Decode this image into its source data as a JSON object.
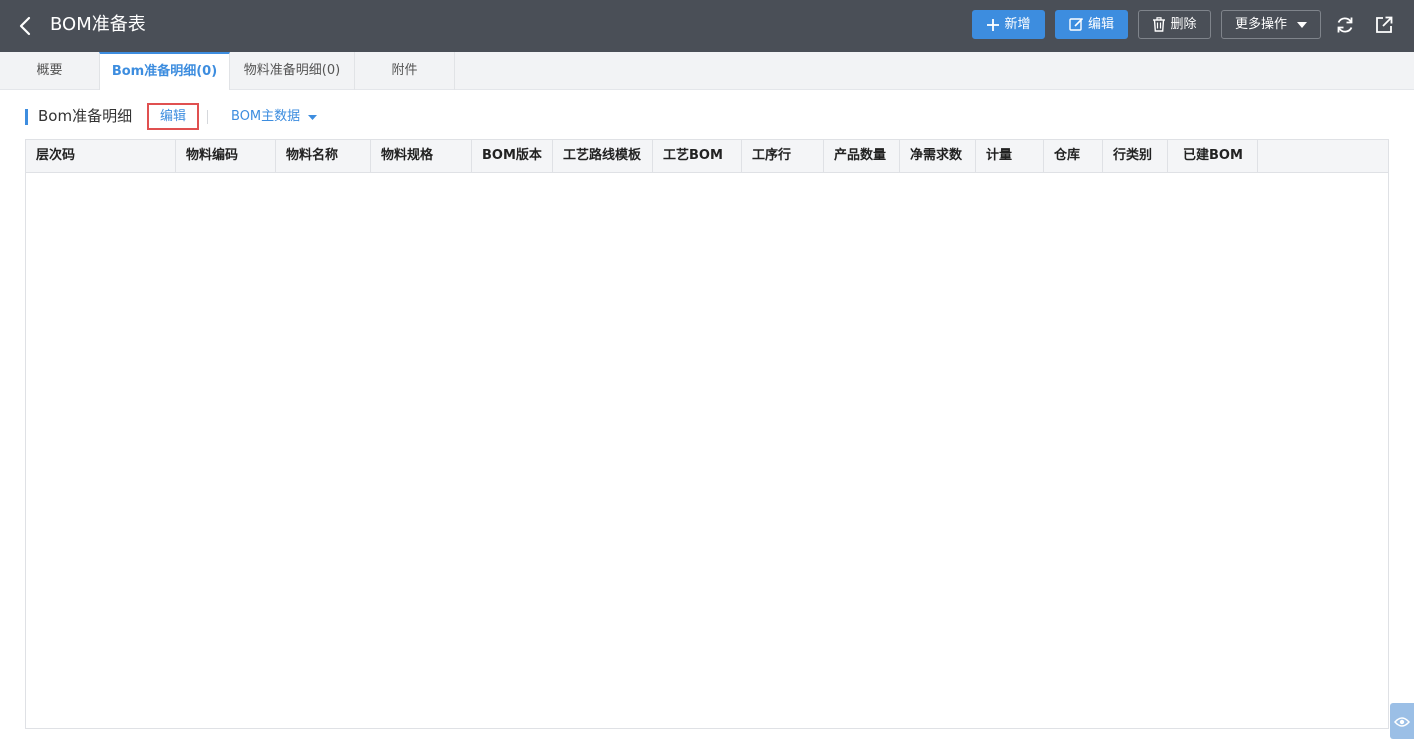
{
  "header": {
    "title": "BOM准备表",
    "buttons": {
      "add": "新增",
      "edit": "编辑",
      "delete": "删除",
      "more": "更多操作"
    }
  },
  "tabs": [
    {
      "label": "概要"
    },
    {
      "label": "Bom准备明细(0)"
    },
    {
      "label": "物料准备明细(0)"
    },
    {
      "label": "附件"
    }
  ],
  "section": {
    "title": "Bom准备明细",
    "edit_label": "编辑",
    "dropdown_label": "BOM主数据"
  },
  "table": {
    "columns": [
      "层次码",
      "物料编码",
      "物料名称",
      "物料规格",
      "BOM版本",
      "工艺路线模板",
      "工艺BOM",
      "工序行",
      "产品数量",
      "净需求数",
      "计量",
      "仓库",
      "行类别",
      "已建BOM"
    ],
    "rows": []
  },
  "colors": {
    "header_bg": "#4a4f57",
    "primary": "#3d8ddf",
    "highlight_border": "#e05050"
  }
}
